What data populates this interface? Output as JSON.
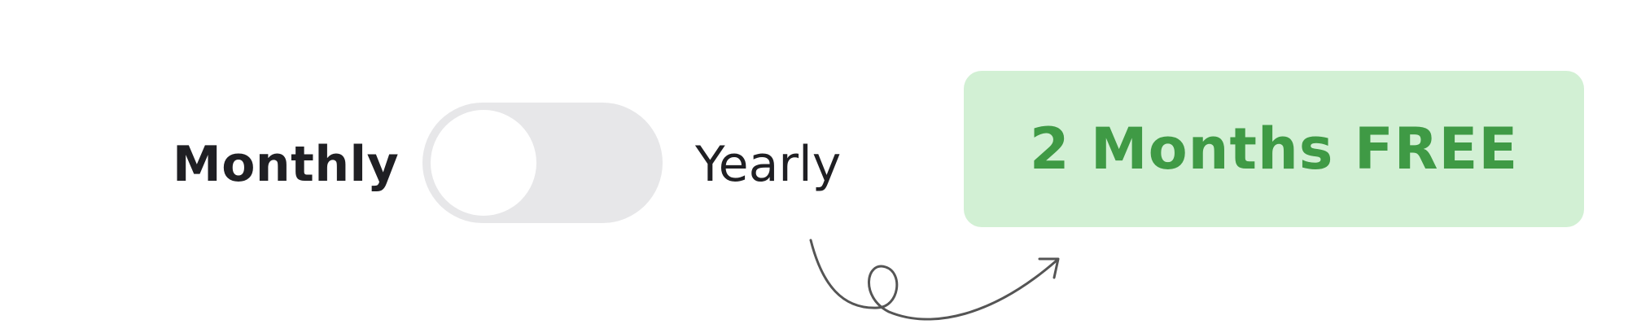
{
  "billing_toggle": {
    "monthly_label": "Monthly",
    "yearly_label": "Yearly",
    "selected": "Monthly",
    "switch_on": false
  },
  "promo": {
    "text": "2 Months FREE"
  },
  "colors": {
    "text": "#1f1f23",
    "track": "#e7e7e9",
    "knob": "#ffffff",
    "badge_bg": "#d2f0d4",
    "badge_text": "#3f9a45",
    "arrow": "#555555"
  },
  "icons": {
    "arrow": "curly-arrow-icon"
  }
}
